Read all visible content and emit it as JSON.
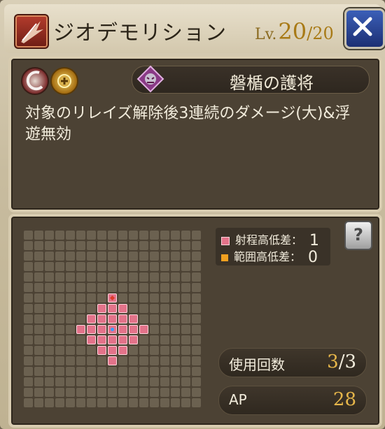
{
  "header": {
    "skill_name": "ジオデモリション",
    "level_label": "Lv.",
    "level_current": "20",
    "level_max": "/20",
    "close_icon": "close-icon"
  },
  "ability": {
    "element_icons": [
      "slash-element-icon",
      "light-element-icon"
    ],
    "ability_icon": "demon-guard-icon",
    "name": "磐楯の護将",
    "description": "対象のリレイズ解除後3連続のダメージ(大)&浮遊無効"
  },
  "range": {
    "legend": [
      {
        "label": "射程高低差：",
        "value": "1",
        "color": "#e3738a"
      },
      {
        "label": "範囲高低差：",
        "value": "0",
        "color": "#f0a020"
      }
    ],
    "help_label": "?"
  },
  "stats": {
    "uses_label": "使用回数",
    "uses_current": "3",
    "uses_max": "/3",
    "ap_label": "AP",
    "ap_value": "28"
  },
  "colors": {
    "range_cell": "#e3738a",
    "center_marker": "#3aa0ff",
    "target_marker": "#e03a2a",
    "accent_gold": "#e6b64a"
  }
}
